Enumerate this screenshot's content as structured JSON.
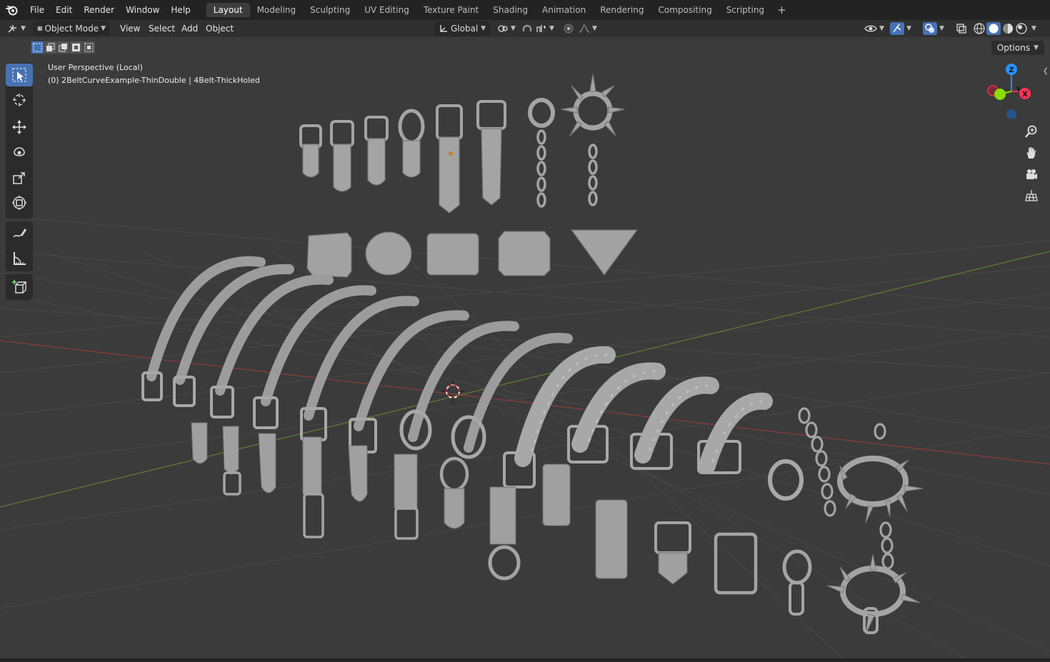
{
  "topbar": {
    "menus": [
      "File",
      "Edit",
      "Render",
      "Window",
      "Help"
    ],
    "workspaces": [
      "Layout",
      "Modeling",
      "Sculpting",
      "UV Editing",
      "Texture Paint",
      "Shading",
      "Animation",
      "Rendering",
      "Compositing",
      "Scripting"
    ],
    "active_workspace": "Layout",
    "add_tab": "+"
  },
  "header": {
    "mode": "Object Mode",
    "menus": [
      "View",
      "Select",
      "Add",
      "Object"
    ],
    "transform_orientation": "Global"
  },
  "viewport": {
    "view_name": "User Perspective (Local)",
    "object_info": "(0) 2BeltCurveExample-ThinDouble | 4Belt-ThickHoled",
    "options_label": "Options"
  },
  "gizmo": {
    "z": "Z",
    "y": "Y",
    "x": "X"
  },
  "colors": {
    "accent": "#4772b3",
    "x_axis": "#ff3352",
    "y_axis": "#8bdc00",
    "z_axis": "#2890ff",
    "viewport_bg": "#3b3b3b",
    "model_gray": "#a9a9a9"
  },
  "icons": {
    "left_tools": [
      "select-box-icon",
      "cursor-icon",
      "move-icon",
      "rotate-icon",
      "scale-icon",
      "transform-icon",
      "annotate-icon",
      "measure-icon",
      "add-cube-icon"
    ],
    "nav": [
      "zoom-icon",
      "hand-pan-icon",
      "camera-icon",
      "grid-ortho-icon"
    ]
  }
}
